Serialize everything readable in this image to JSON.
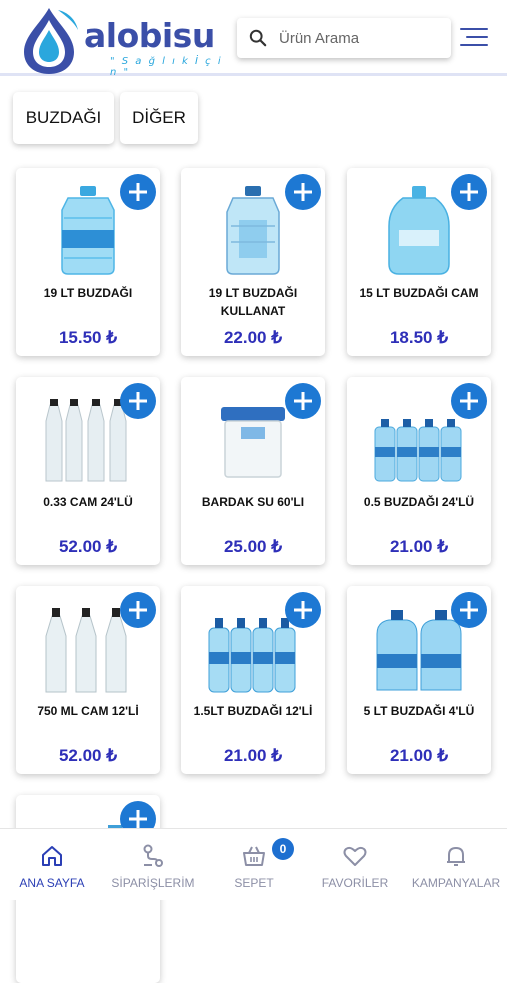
{
  "brand": {
    "name": "alobisu",
    "tagline": "\" S a ğ l ı k  İ ç i n \""
  },
  "search": {
    "placeholder": "Ürün Arama"
  },
  "categories": [
    {
      "label": "BUZDAĞI"
    },
    {
      "label": "DİĞER"
    }
  ],
  "products": [
    {
      "name": "19 LT BUZDAĞI",
      "price": "15.50 ₺",
      "image": "water-jug-19lt-icon"
    },
    {
      "name": "19 LT BUZDAĞI KULLANAT",
      "price": "22.00 ₺",
      "image": "water-jug-disposable-icon"
    },
    {
      "name": "15 LT BUZDAĞI CAM",
      "price": "18.50 ₺",
      "image": "glass-jug-15lt-icon"
    },
    {
      "name": "0.33 CAM 24'LÜ",
      "price": "52.00 ₺",
      "image": "glass-bottles-pack-icon"
    },
    {
      "name": "BARDAK SU 60'LI",
      "price": "25.00 ₺",
      "image": "water-cups-box-icon"
    },
    {
      "name": "0.5 BUZDAĞI 24'LÜ",
      "price": "21.00 ₺",
      "image": "small-bottles-pack-icon"
    },
    {
      "name": "750 ML CAM 12'Lİ",
      "price": "52.00 ₺",
      "image": "glass-bottles-750-icon"
    },
    {
      "name": "1.5LT BUZDAĞI 12'Lİ",
      "price": "21.00 ₺",
      "image": "bottles-1-5lt-pack-icon"
    },
    {
      "name": "5 LT BUZDAĞI 4'LÜ",
      "price": "21.00 ₺",
      "image": "bottles-5lt-pack-icon"
    },
    {
      "name": "",
      "price": "",
      "image": "bottle-partial-icon"
    }
  ],
  "nav": {
    "home": "ANA SAYFA",
    "orders": "SİPARİŞLERİM",
    "cart": "SEPET",
    "cart_count": "0",
    "favorites": "FAVORİLER",
    "campaigns": "KAMPANYALAR"
  },
  "colors": {
    "accent": "#1d78d3",
    "brand": "#3b4fa8",
    "price": "#2e2fb8",
    "water": "#5ec3ec"
  }
}
